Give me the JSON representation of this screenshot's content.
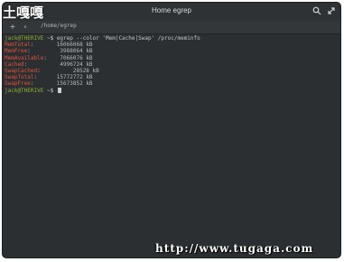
{
  "window": {
    "title": "Home egrep"
  },
  "titlebar": {
    "search_icon": "search-icon",
    "maximize_icon": "maximize-icon"
  },
  "pathbar": {
    "back_icon": "plus-icon",
    "forward_icon": "chevron-left-icon",
    "path": "/home/egrep"
  },
  "terminal": {
    "prompt_user": "jack@THERIVE",
    "prompt_symbol": " ~$ ",
    "command": "egrep --color 'Mem|Cache|Swap' /proc/meminfo",
    "rows": [
      {
        "key": "MemTotal",
        "value": ":       16066068 kB"
      },
      {
        "key": "MemFree",
        "value": ":         3988064 kB"
      },
      {
        "key": "MemAvailable",
        "value": ":    7066076 kB"
      },
      {
        "key": "Cached",
        "value": ":          4996724 kB"
      },
      {
        "key": "SwapCached",
        "value": ":          28528 kB"
      },
      {
        "key": "SwapTotal",
        "value": ":      15772772 kB"
      },
      {
        "key": "SwapFree",
        "value": ":       15673852 kB"
      }
    ],
    "final_prompt_user": "jack@THERIVE",
    "final_prompt_symbol": " ~$ "
  },
  "watermark": {
    "logo": "土嘎嘎",
    "url": "http://www.tugaga.com"
  }
}
